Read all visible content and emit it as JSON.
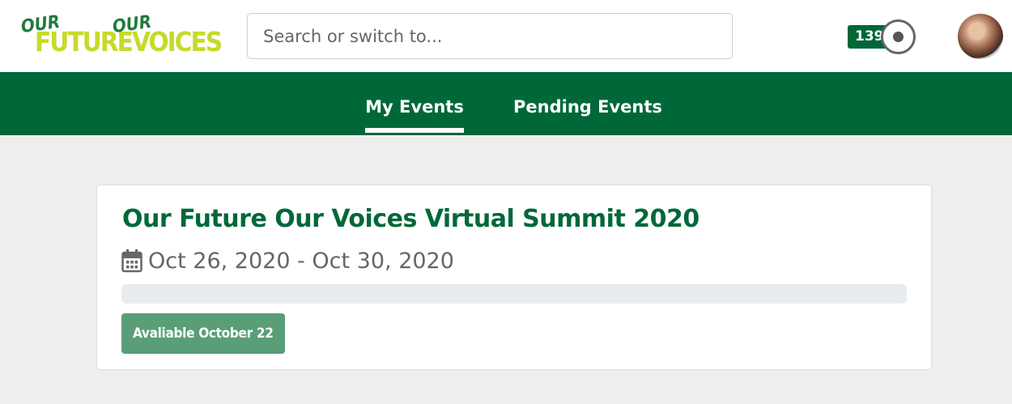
{
  "logo": {
    "our_1": "OUR",
    "future": "FUTURE",
    "our_2": "OUR",
    "voices": "VOICES"
  },
  "search": {
    "placeholder": "Search or switch to..."
  },
  "header": {
    "points": "139"
  },
  "nav": {
    "tabs": [
      {
        "label": "My Events",
        "active": true
      },
      {
        "label": "Pending Events",
        "active": false
      }
    ]
  },
  "event": {
    "title": "Our Future Our Voices Virtual Summit 2020",
    "dates": "Oct 26, 2020 - Oct 30, 2020",
    "progress": 0,
    "availability_label": "Avaliable October 22"
  },
  "colors": {
    "brand_green": "#006838",
    "logo_yellow": "#c8d92a",
    "button_green": "#5a9e78"
  },
  "icons": {
    "calendar": "calendar-icon",
    "record": "record-icon"
  }
}
